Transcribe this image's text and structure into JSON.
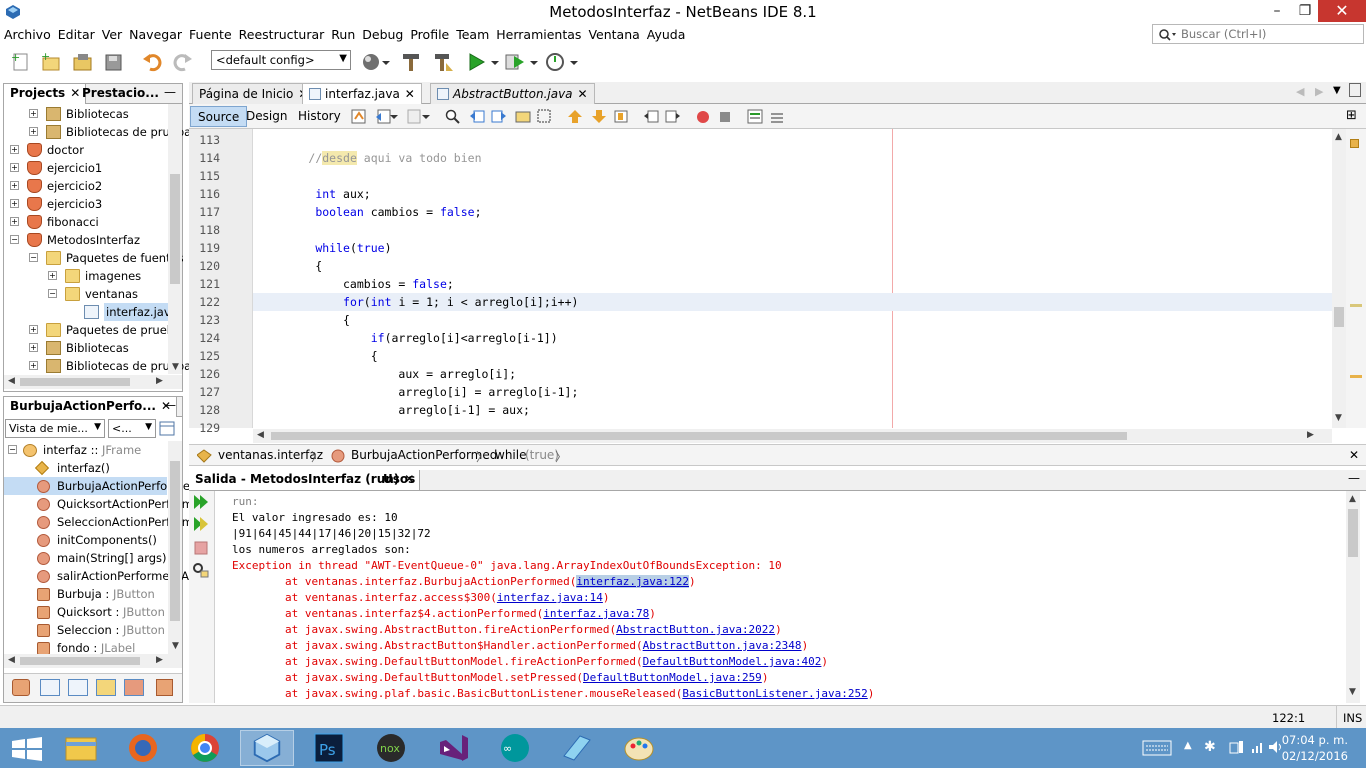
{
  "window": {
    "title": "MetodosInterfaz - NetBeans IDE 8.1",
    "minimize": "–",
    "maximize": "❐",
    "close": "✕"
  },
  "menu": [
    "Archivo",
    "Editar",
    "Ver",
    "Navegar",
    "Fuente",
    "Reestructurar",
    "Run",
    "Debug",
    "Profile",
    "Team",
    "Herramientas",
    "Ventana",
    "Ayuda"
  ],
  "search": {
    "placeholder": "Buscar (Ctrl+I)"
  },
  "toolbar": {
    "config": "<default config>"
  },
  "projects_panel": {
    "tabs": [
      "Projects",
      "Prestacio..."
    ],
    "tree": [
      {
        "label": "Bibliotecas",
        "indent": 1,
        "icon": "lib",
        "exp": "+"
      },
      {
        "label": "Bibliotecas de prueba",
        "indent": 1,
        "icon": "lib",
        "exp": "+"
      },
      {
        "label": "doctor",
        "indent": 0,
        "icon": "cup",
        "exp": "+"
      },
      {
        "label": "ejercicio1",
        "indent": 0,
        "icon": "cup",
        "exp": "+"
      },
      {
        "label": "ejercicio2",
        "indent": 0,
        "icon": "cup",
        "exp": "+"
      },
      {
        "label": "ejercicio3",
        "indent": 0,
        "icon": "cup",
        "exp": "+"
      },
      {
        "label": "fibonacci",
        "indent": 0,
        "icon": "cup",
        "exp": "+"
      },
      {
        "label": "MetodosInterfaz",
        "indent": 0,
        "icon": "cup",
        "exp": "−"
      },
      {
        "label": "Paquetes de fuentes",
        "indent": 1,
        "icon": "folder",
        "exp": "−"
      },
      {
        "label": "imagenes",
        "indent": 2,
        "icon": "folder",
        "exp": "+"
      },
      {
        "label": "ventanas",
        "indent": 2,
        "icon": "folder",
        "exp": "−"
      },
      {
        "label": "interfaz.java",
        "indent": 3,
        "icon": "file",
        "exp": "",
        "selected": true
      },
      {
        "label": "Paquetes de prueba",
        "indent": 1,
        "icon": "folder",
        "exp": "+"
      },
      {
        "label": "Bibliotecas",
        "indent": 1,
        "icon": "lib",
        "exp": "+"
      },
      {
        "label": "Bibliotecas de prueba",
        "indent": 1,
        "icon": "lib",
        "exp": "+"
      }
    ]
  },
  "navigator_panel": {
    "title": "BurbujaActionPerfo...",
    "view_select": "Vista de mie...",
    "filter_select": "<...",
    "tree": [
      {
        "label": "interfaz :: ",
        "suffix": "JFrame",
        "icon": "class",
        "indent": 0
      },
      {
        "label": "interfaz()",
        "suffix": "",
        "icon": "diamond",
        "indent": 1
      },
      {
        "label": "BurbujaActionPerformed(",
        "suffix": "",
        "icon": "method",
        "indent": 1,
        "selected": true
      },
      {
        "label": "QuicksortActionPerforme",
        "suffix": "",
        "icon": "method",
        "indent": 1
      },
      {
        "label": "SeleccionActionPerforme",
        "suffix": "",
        "icon": "method",
        "indent": 1
      },
      {
        "label": "initComponents()",
        "suffix": "",
        "icon": "method",
        "indent": 1
      },
      {
        "label": "main(String[] args)",
        "suffix": "",
        "icon": "method",
        "indent": 1
      },
      {
        "label": "salirActionPerformed(Act",
        "suffix": "",
        "icon": "method",
        "indent": 1
      },
      {
        "label": "Burbuja : ",
        "suffix": "JButton",
        "icon": "field",
        "indent": 1
      },
      {
        "label": "Quicksort : ",
        "suffix": "JButton",
        "icon": "field",
        "indent": 1
      },
      {
        "label": "Seleccion : ",
        "suffix": "JButton",
        "icon": "field",
        "indent": 1
      },
      {
        "label": "fondo : ",
        "suffix": "JLabel",
        "icon": "field",
        "indent": 1
      }
    ]
  },
  "editor": {
    "tabs": [
      {
        "label": "Página de Inicio",
        "italic": false,
        "active": false
      },
      {
        "label": "interfaz.java",
        "italic": false,
        "active": true
      },
      {
        "label": "AbstractButton.java",
        "italic": true,
        "active": false
      }
    ],
    "subtabs": [
      "Source",
      "Design",
      "History"
    ],
    "lines": [
      {
        "n": "113",
        "html": ""
      },
      {
        "n": "114",
        "html": "        <span class=\"cm\">//<span class=\"hl\">desde</span> aqui va todo bien</span>"
      },
      {
        "n": "115",
        "html": ""
      },
      {
        "n": "116",
        "html": "         <span class=\"kw\">int</span> aux;"
      },
      {
        "n": "117",
        "html": "         <span class=\"kw\">boolean</span> cambios = <span class=\"kw\">false</span>;"
      },
      {
        "n": "118",
        "html": ""
      },
      {
        "n": "119",
        "html": "         <span class=\"kw\">while</span>(<span class=\"kw\">true</span>)"
      },
      {
        "n": "120",
        "html": "         {"
      },
      {
        "n": "121",
        "html": "             cambios = <span class=\"kw\">false</span>;"
      },
      {
        "n": "122",
        "html": "             <span class=\"kw\">for</span>(<span class=\"kw\">int</span> i = 1; i &lt; arreglo[i];i++)",
        "current": true
      },
      {
        "n": "123",
        "html": "             {"
      },
      {
        "n": "124",
        "html": "                 <span class=\"kw\">if</span>(arreglo[i]&lt;arreglo[i-1])"
      },
      {
        "n": "125",
        "html": "                 {"
      },
      {
        "n": "126",
        "html": "                     aux = arreglo[i];"
      },
      {
        "n": "127",
        "html": "                     arreglo[i] = arreglo[i-1];"
      },
      {
        "n": "128",
        "html": "                     arreglo[i-1] = aux;"
      },
      {
        "n": "129",
        "html": ""
      }
    ]
  },
  "breadcrumb": [
    "ventanas.interfaz",
    "BurbujaActionPerformed",
    "while",
    "(true)"
  ],
  "output": {
    "tabs": [
      "Salida - MetodosInterfaz (run)",
      "Usos"
    ],
    "lines": [
      {
        "html": "<span class=\"gray\">run:</span>"
      },
      {
        "html": "El valor ingresado es: 10"
      },
      {
        "html": "|91|64|45|44|17|46|20|15|32|72"
      },
      {
        "html": "los numeros arreglados son:"
      },
      {
        "html": "<span class=\"err\">Exception in thread \"AWT-EventQueue-0\" java.lang.ArrayIndexOutOfBoundsException: 10</span>"
      },
      {
        "html": "<span class=\"err\">        at ventanas.interfaz.BurbujaActionPerformed(<span class=\"lnk sel\">interfaz.java:122</span>)</span>"
      },
      {
        "html": "<span class=\"err\">        at ventanas.interfaz.access$300(<span class=\"lnk\">interfaz.java:14</span>)</span>"
      },
      {
        "html": "<span class=\"err\">        at ventanas.interfaz$4.actionPerformed(<span class=\"lnk\">interfaz.java:78</span>)</span>"
      },
      {
        "html": "<span class=\"err\">        at javax.swing.AbstractButton.fireActionPerformed(<span class=\"lnk\">AbstractButton.java:2022</span>)</span>"
      },
      {
        "html": "<span class=\"err\">        at javax.swing.AbstractButton$Handler.actionPerformed(<span class=\"lnk\">AbstractButton.java:2348</span>)</span>"
      },
      {
        "html": "<span class=\"err\">        at javax.swing.DefaultButtonModel.fireActionPerformed(<span class=\"lnk\">DefaultButtonModel.java:402</span>)</span>"
      },
      {
        "html": "<span class=\"err\">        at javax.swing.DefaultButtonModel.setPressed(<span class=\"lnk\">DefaultButtonModel.java:259</span>)</span>"
      },
      {
        "html": "<span class=\"err\">        at javax.swing.plaf.basic.BasicButtonListener.mouseReleased(<span class=\"lnk\">BasicButtonListener.java:252</span>)</span>"
      }
    ]
  },
  "status": {
    "position": "122:1",
    "mode": "INS"
  },
  "clock": {
    "time": "07:04 p. m.",
    "date": "02/12/2016"
  },
  "colors": {
    "taskbar": "#5e95c7",
    "keyword": "#0000e6",
    "error": "#e00000",
    "close_button": "#c7362f"
  }
}
